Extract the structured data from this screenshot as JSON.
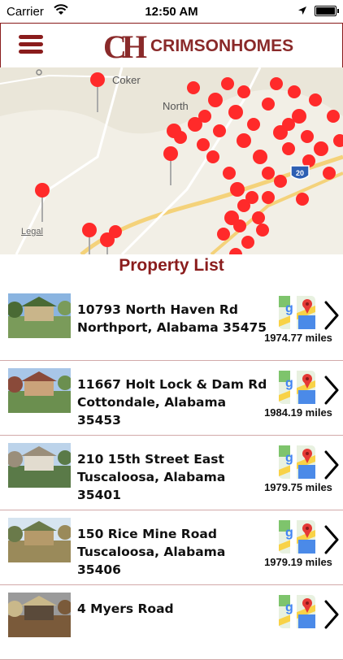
{
  "status": {
    "carrier": "Carrier",
    "time": "12:50 AM"
  },
  "header": {
    "logo_mono": "CH",
    "logo_word": "CRIMSONHOMES"
  },
  "map": {
    "labels": [
      "Coker",
      "North",
      "Legal"
    ],
    "highway": "20"
  },
  "section_title": "Property List",
  "properties": [
    {
      "line1": "10793 North Haven Rd",
      "line2": "Northport, Alabama 35475",
      "distance": "1974.77 miles"
    },
    {
      "line1": "11667 Holt Lock & Dam Rd",
      "line2": "Cottondale, Alabama 35453",
      "distance": "1984.19 miles"
    },
    {
      "line1": "210 15th Street East",
      "line2": "Tuscaloosa, Alabama 35401",
      "distance": "1979.75 miles"
    },
    {
      "line1": "150 Rice Mine Road",
      "line2": "Tuscaloosa, Alabama 35406",
      "distance": "1979.19 miles"
    },
    {
      "line1": "4 Myers Road",
      "line2": "",
      "distance": ""
    }
  ],
  "colors": {
    "accent": "#8a1c1c",
    "pin": "#ff2a2a",
    "divider": "#d2a9a9"
  }
}
